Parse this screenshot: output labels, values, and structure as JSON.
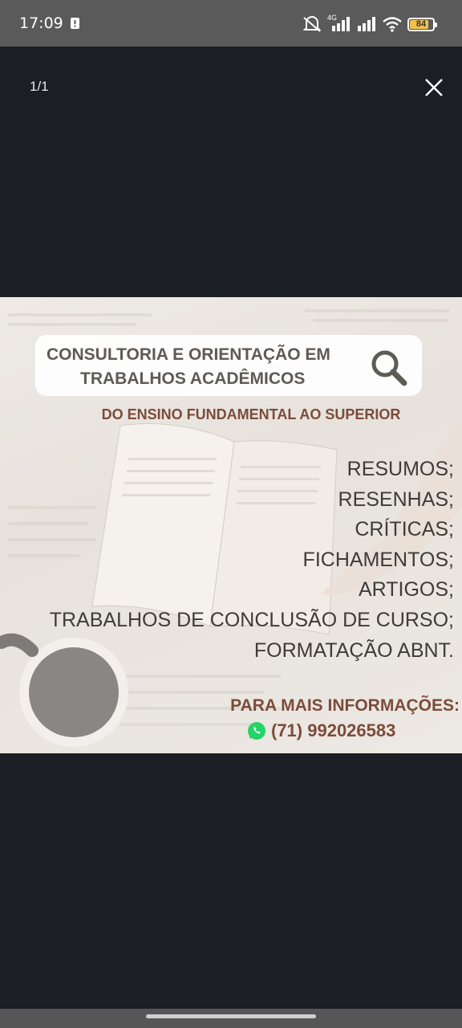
{
  "status_bar": {
    "time": "17:09",
    "network_label": "4G",
    "battery": "84",
    "battery_level": 0.84,
    "icons": [
      "sim-alert-icon",
      "mute-icon",
      "signal-icon",
      "signal-icon",
      "wifi-icon",
      "battery-icon"
    ]
  },
  "viewer": {
    "page_counter": "1/1",
    "close_icon": "close-icon"
  },
  "poster": {
    "title_line1": "CONSULTORIA E ORIENTAÇÃO EM",
    "title_line2": "TRABALHOS ACADÊMICOS",
    "search_icon": "magnifier-icon",
    "subtitle": "DO ENSINO FUNDAMENTAL AO SUPERIOR",
    "services": [
      "RESUMOS;",
      "RESENHAS;",
      "CRÍTICAS;",
      "FICHAMENTOS;",
      "ARTIGOS;",
      "TRABALHOS DE CONCLUSÃO DE CURSO;",
      "FORMATAÇÃO ABNT."
    ],
    "info_label": "PARA MAIS INFORMAÇÕES:",
    "phone": "(71) 992026583",
    "phone_icon": "whatsapp-icon",
    "colors": {
      "accent_brown": "#7b4c3a",
      "text_dark": "#3f3b38",
      "whatsapp_green": "#25d366"
    }
  }
}
